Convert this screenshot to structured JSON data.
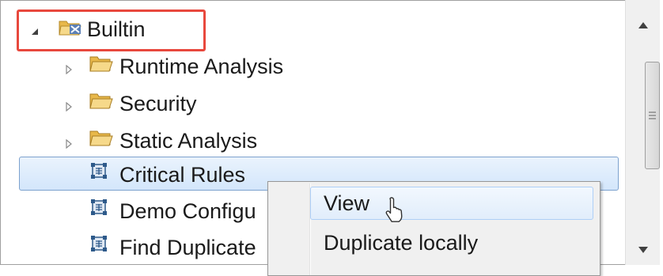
{
  "tree": {
    "root": {
      "label": "Builtin",
      "expanded": true,
      "icon": "builtin-folder-icon"
    },
    "folders": [
      {
        "label": "Runtime Analysis",
        "icon": "folder-open-icon"
      },
      {
        "label": "Security",
        "icon": "folder-open-icon"
      },
      {
        "label": "Static Analysis",
        "icon": "folder-open-icon"
      }
    ],
    "configs": [
      {
        "label": "Critical Rules",
        "icon": "config-icon",
        "selected": true
      },
      {
        "label": "Demo Configu",
        "icon": "config-icon"
      },
      {
        "label": "Find Duplicate",
        "icon": "config-icon"
      }
    ]
  },
  "context_menu": {
    "items": [
      {
        "label": "View",
        "hover": true
      },
      {
        "label": "Duplicate locally"
      }
    ]
  },
  "colors": {
    "highlight_box": "#e8483d",
    "selection_fill": "#d3e6fb",
    "selection_border": "#7da2ce",
    "folder": "#f0c75a"
  }
}
